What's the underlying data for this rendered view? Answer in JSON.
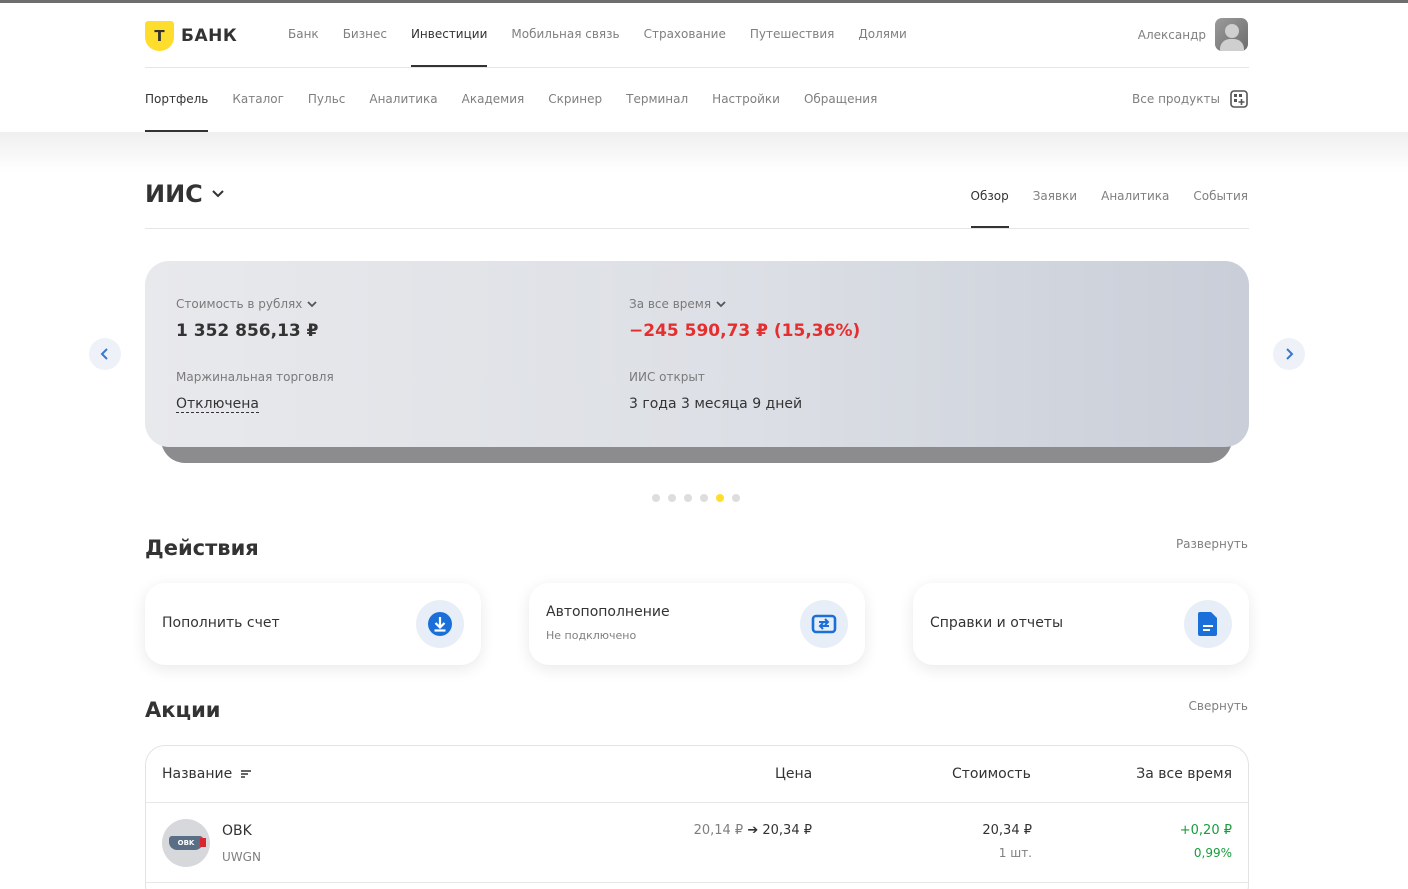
{
  "brand": {
    "name": "БАНК",
    "mark": "Т"
  },
  "top_nav": [
    "Банк",
    "Бизнес",
    "Инвестиции",
    "Мобильная связь",
    "Страхование",
    "Путешествия",
    "Долями"
  ],
  "top_nav_active": "Инвестиции",
  "user": {
    "name": "Александр"
  },
  "sub_nav": [
    "Портфель",
    "Каталог",
    "Пульс",
    "Аналитика",
    "Академия",
    "Скринер",
    "Терминал",
    "Настройки",
    "Обращения"
  ],
  "sub_nav_active": "Портфель",
  "all_products": "Все продукты",
  "account": {
    "title": "ИИС",
    "tabs": [
      "Обзор",
      "Заявки",
      "Аналитика",
      "События"
    ],
    "active_tab": "Обзор"
  },
  "summary": {
    "value_label": "Стоимость в рублях",
    "value": "1 352 856,13 ₽",
    "alltime_label": "За все время",
    "alltime": "−245 590,73 ₽ (15,36%)",
    "margin_label": "Маржинальная торговля",
    "margin_value": "Отключена",
    "opened_label": "ИИС открыт",
    "opened_value": "3 года 3 месяца 9 дней",
    "carousel_total": 6,
    "carousel_active": 5
  },
  "actions": {
    "title": "Действия",
    "expand": "Развернуть",
    "items": [
      {
        "title": "Пополнить счет",
        "subtitle": "",
        "icon": "download-icon"
      },
      {
        "title": "Автопополнение",
        "subtitle": "Не подключено",
        "icon": "repeat-icon"
      },
      {
        "title": "Справки и отчеты",
        "subtitle": "",
        "icon": "document-icon"
      }
    ]
  },
  "stocks": {
    "title": "Акции",
    "collapse": "Свернуть",
    "columns": {
      "name": "Название",
      "price": "Цена",
      "value": "Стоимость",
      "alltime": "За все время"
    },
    "rows": [
      {
        "name": "OBK",
        "ticker": "UWGN",
        "price_from": "20,14 ₽",
        "price_to": "20,34 ₽",
        "value": "20,34 ₽",
        "qty": "1 шт.",
        "change": "+0,20 ₽",
        "change_pct": "0,99%"
      }
    ]
  },
  "colors": {
    "accent": "#ffdd2d",
    "negative": "#e52e2e",
    "positive": "#189d3d",
    "icon_blue": "#1b6fd8"
  }
}
